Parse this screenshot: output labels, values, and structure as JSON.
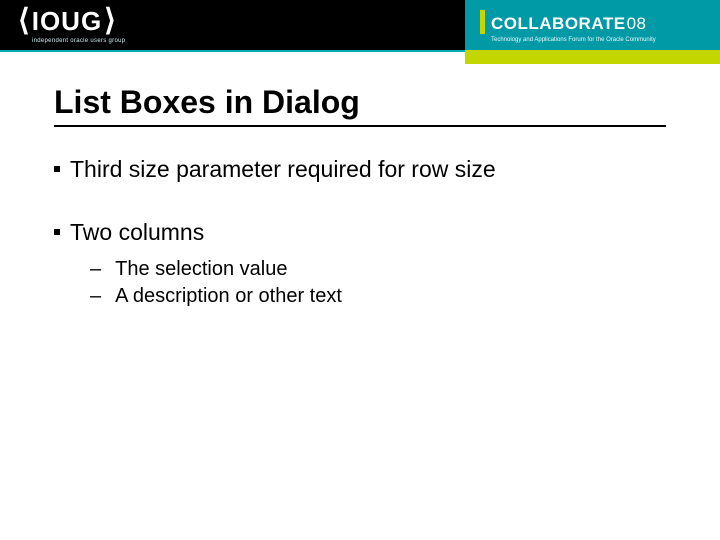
{
  "header": {
    "ioug_logo_text": "IOUG",
    "ioug_logo_sub": "independent oracle users group",
    "collab_logo_text": "COLLABORATE",
    "collab_logo_year": "08",
    "collab_logo_sub": "Technology and Applications Forum for the Oracle Community"
  },
  "slide": {
    "title": "List Boxes in Dialog",
    "bullets": [
      {
        "text": "Third size parameter required for row size",
        "children": []
      },
      {
        "text": "Two columns",
        "children": [
          {
            "text": "The selection value"
          },
          {
            "text": "A description or other text"
          }
        ]
      }
    ]
  }
}
